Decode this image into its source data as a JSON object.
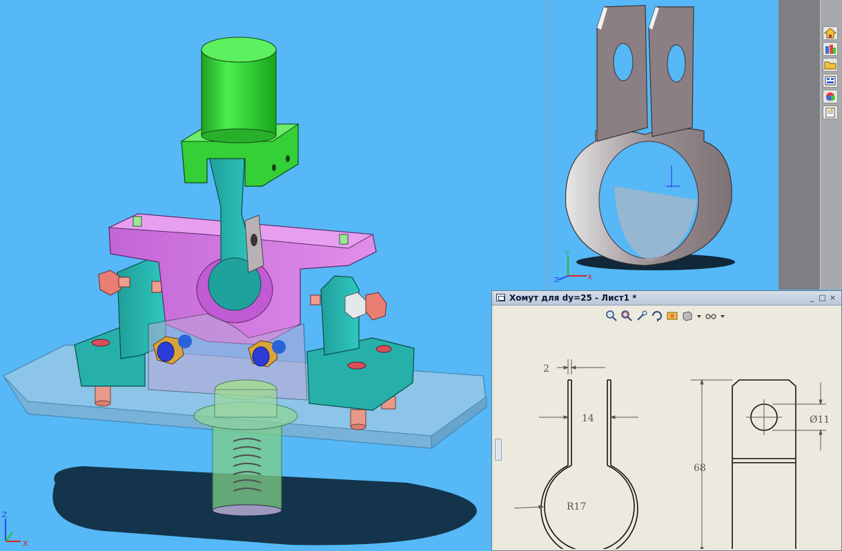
{
  "drawing_window": {
    "title": "Хомут для dy=25 - Лист1 *",
    "controls": [
      "_",
      "□",
      "×"
    ],
    "toolbar_icons": [
      "zoom-to-fit-icon",
      "zoom-to-area-icon",
      "zoom-in-out-icon",
      "rotate-icon",
      "pan-icon",
      "display-style-icon",
      "view-orientation-icon"
    ]
  },
  "drawing_dimensions": {
    "thickness": "2",
    "gap": "14",
    "radius": "R17",
    "height": "68",
    "hole_diameter": "Ø11"
  },
  "triad": {
    "x": "X",
    "y": "Y",
    "z": "Z"
  },
  "task_pane_icons": [
    "home-icon",
    "design-library-icon",
    "file-explorer-icon",
    "view-palette-icon",
    "appearances-icon",
    "custom-properties-icon"
  ],
  "colors": {
    "viewport_bg": "#56b8f6",
    "sheet_bg": "#eceadf",
    "cylinder": "#36d43a",
    "base_plate": "#8fbfe0",
    "support": "#27b5ad",
    "pink_block": "#d27ce0",
    "bolt": "#e07a72",
    "clamp_metal": "#8f8388"
  }
}
